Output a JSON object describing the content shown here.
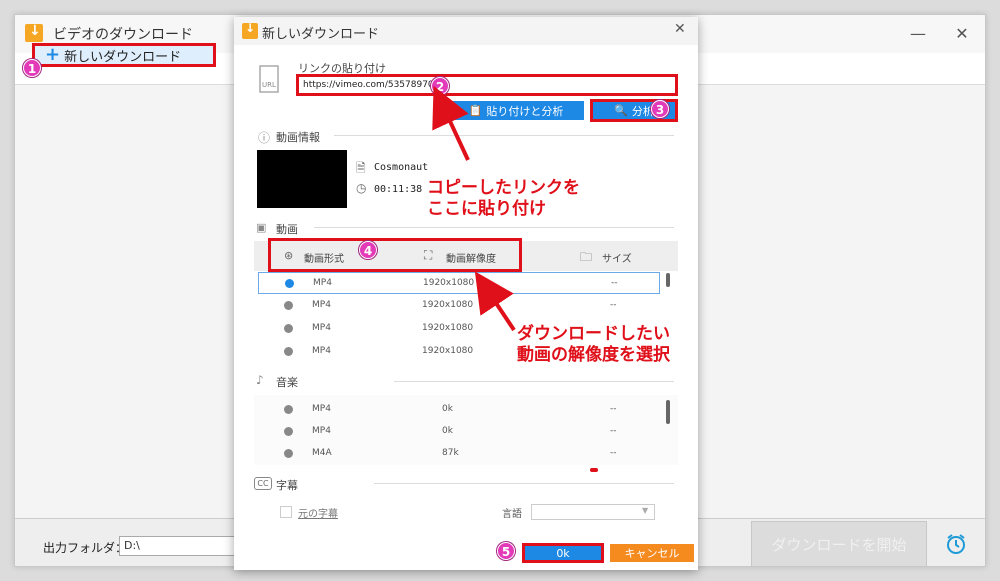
{
  "main": {
    "title": "ビデオのダウンロード",
    "new_download": "新しいダウンロード",
    "output_label": "出力フォルダ：",
    "output_path": "D:\\",
    "start_button": "ダウンロードを開始"
  },
  "dialog": {
    "title": "新しいダウンロード",
    "link_label": "リンクの貼り付け",
    "url_value": "https://vimeo.com/535789702",
    "paste_analyze": "貼り付けと分析",
    "analyze": "分析",
    "video_info_label": "動画情報",
    "video_title": "Cosmonaut",
    "duration": "00:11:38",
    "video_section": "動画",
    "col_format": "動画形式",
    "col_resolution": "動画解像度",
    "col_size": "サイズ",
    "video_rows": [
      {
        "format": "MP4",
        "resolution": "1920x1080",
        "size": "--"
      },
      {
        "format": "MP4",
        "resolution": "1920x1080",
        "size": "--"
      },
      {
        "format": "MP4",
        "resolution": "1920x1080",
        "size": "--"
      },
      {
        "format": "MP4",
        "resolution": "1920x1080",
        "size": "--"
      }
    ],
    "audio_section": "音楽",
    "audio_rows": [
      {
        "format": "MP4",
        "bitrate": "0k",
        "size": "--"
      },
      {
        "format": "MP4",
        "bitrate": "0k",
        "size": "--"
      },
      {
        "format": "M4A",
        "bitrate": "87k",
        "size": "--"
      }
    ],
    "subtitle_section": "字幕",
    "original_subtitle": "元の字幕",
    "language_label": "言語",
    "ok": "0k",
    "cancel": "キャンセル"
  },
  "markers": [
    "1",
    "2",
    "3",
    "4",
    "5"
  ],
  "annotations": {
    "paste_line1": "コピーしたリンクを",
    "paste_line2": "ここに貼り付け",
    "res_line1": "ダウンロードしたい",
    "res_line2": "動画の解像度を選択"
  },
  "colors": {
    "accent": "#1e88e5",
    "highlight": "#e0101a",
    "marker": "#e23ab8",
    "cancel": "#f58a1f"
  }
}
